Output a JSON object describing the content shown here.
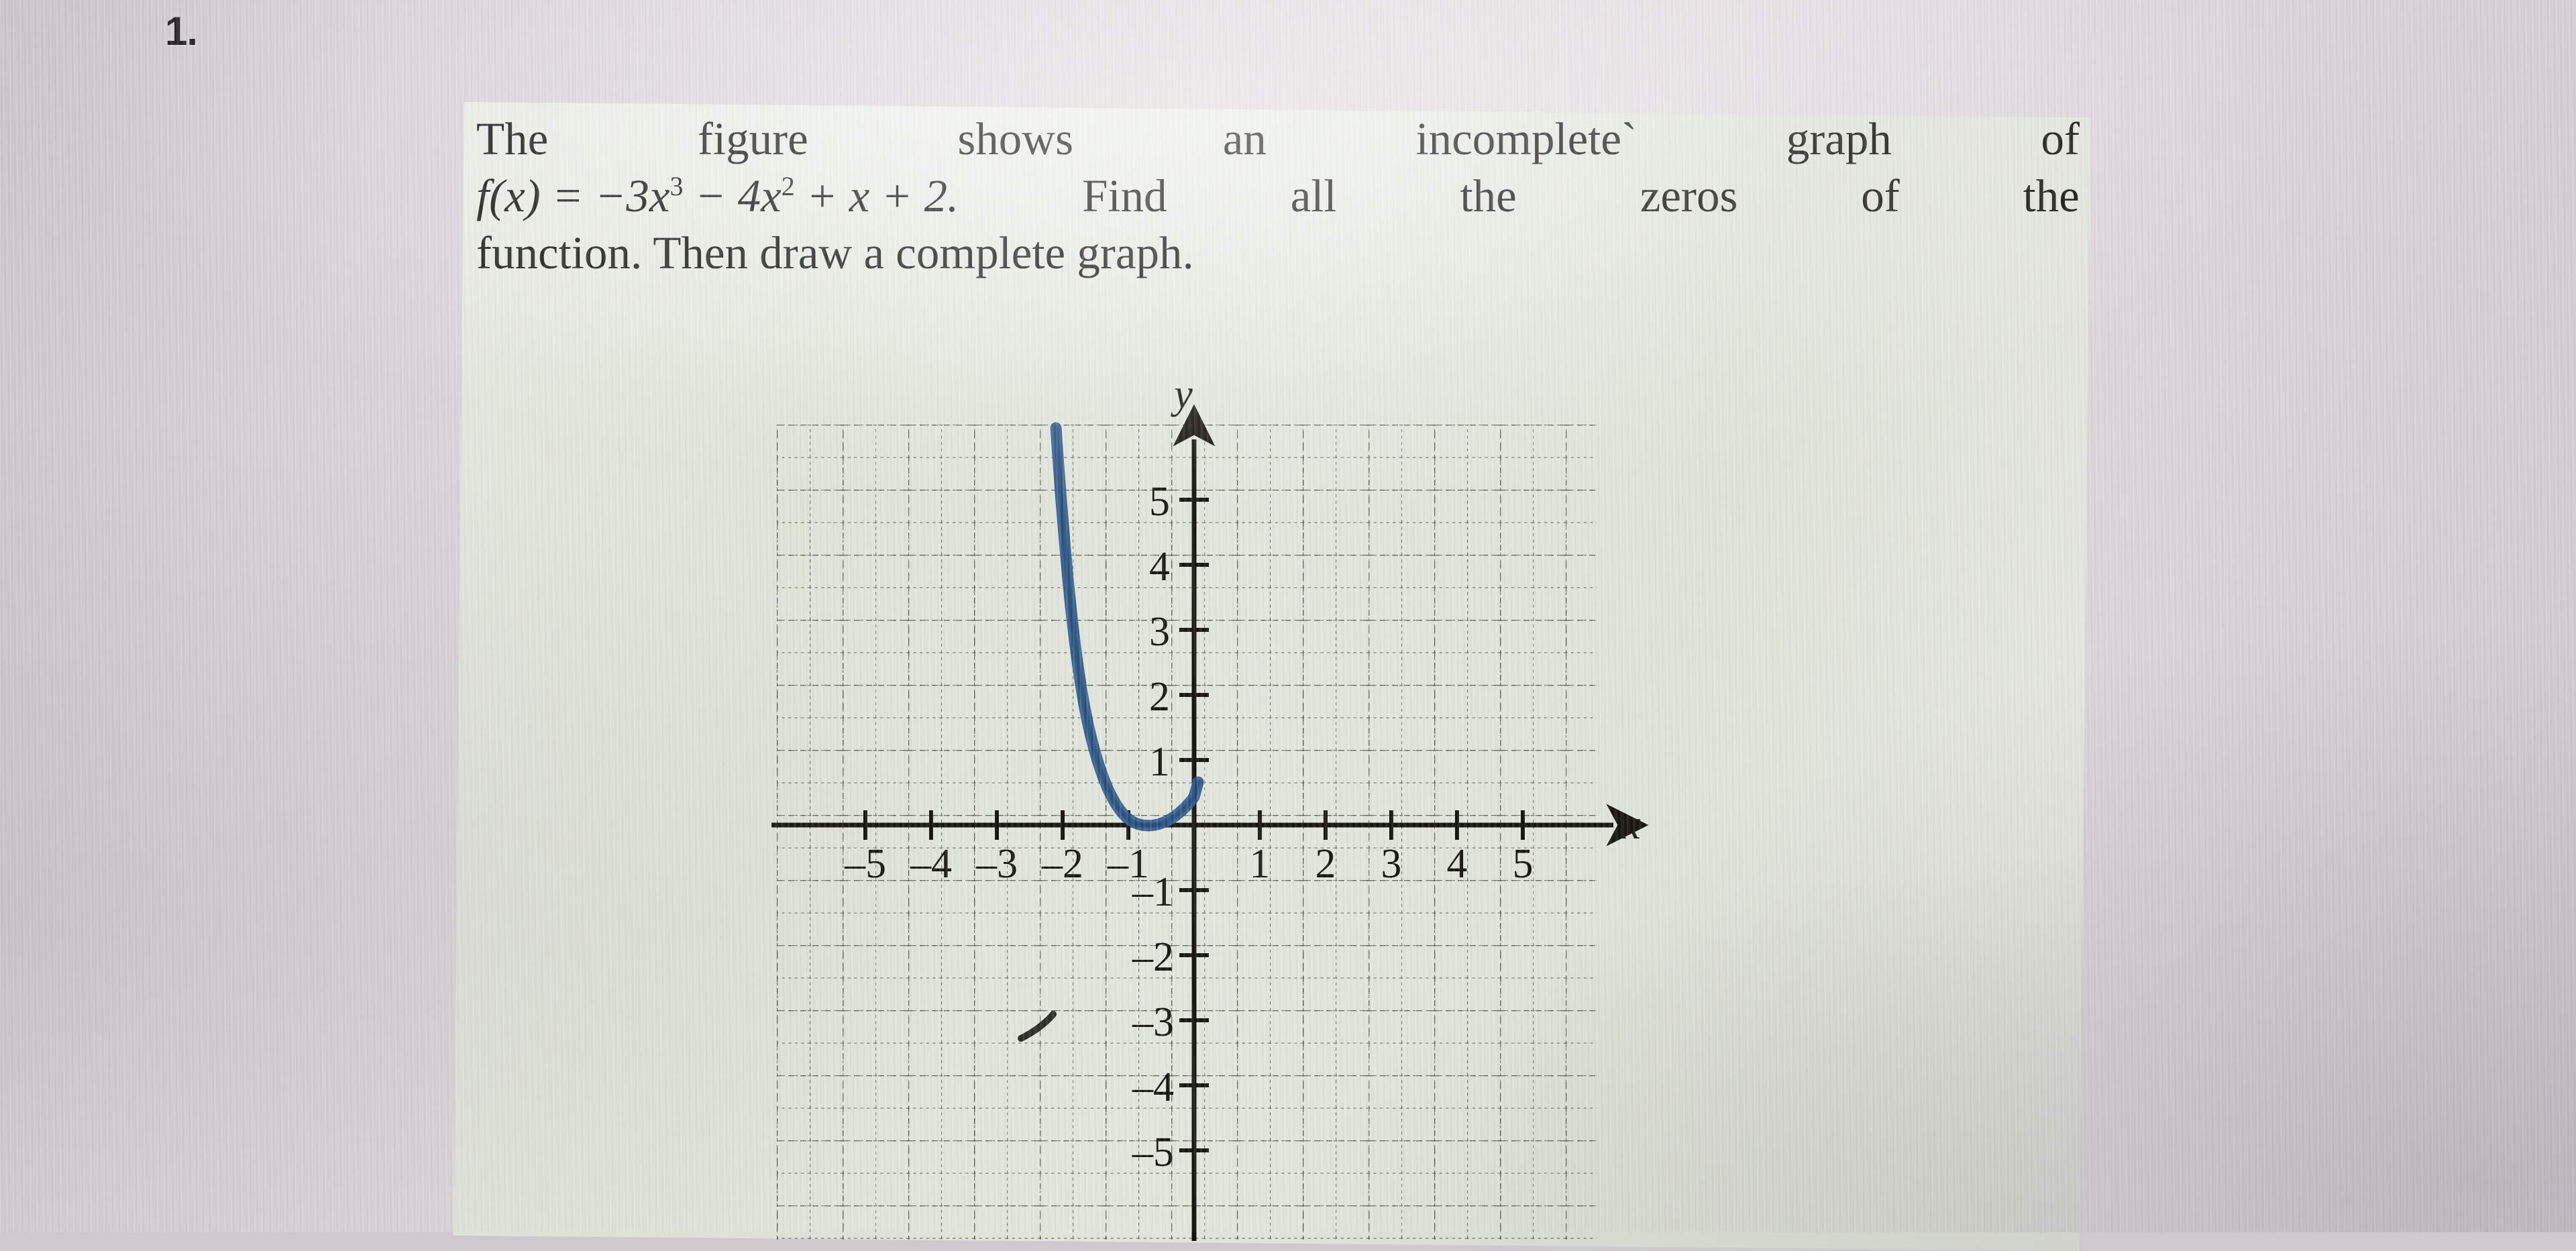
{
  "problem": {
    "number": "1.",
    "line1": [
      "The",
      "figure",
      "shows",
      "an",
      "incomplete`",
      "graph",
      "of"
    ],
    "line2_pre": "f(x) = −3x",
    "line2_exp1": "3",
    "line2_mid": " − 4x",
    "line2_exp2": "2",
    "line2_post": " + x + 2.",
    "line2_words": [
      "Find",
      "all",
      "the",
      "zeros",
      "of",
      "the"
    ],
    "line3": "function. Then draw a complete graph.",
    "full_text": "The figure shows an incomplete graph of f(x) = −3x³ − 4x² + x + 2. Find all the zeros of the function. Then draw a complete graph."
  },
  "chart_data": {
    "type": "line",
    "title": "",
    "xlabel": "x",
    "ylabel": "y",
    "xlim": [
      -6,
      6
    ],
    "ylim": [
      -6,
      6
    ],
    "xticks": [
      -5,
      -4,
      -3,
      -2,
      -1,
      1,
      2,
      3,
      4,
      5
    ],
    "yticks": [
      5,
      4,
      3,
      2,
      1,
      -1,
      -2,
      -3,
      -4,
      -5
    ],
    "xtick_labels": [
      "–5",
      "–4",
      "–3",
      "–2",
      "–1",
      "1",
      "2",
      "3",
      "4",
      "5"
    ],
    "ytick_labels": [
      "5",
      "4",
      "3",
      "2",
      "1",
      "–1",
      "–2",
      "–3",
      "–4",
      "–5"
    ],
    "grid": true,
    "grid_style": "dotted",
    "grid_spacing": 0.5,
    "axis_arrows": true,
    "legend": "none",
    "curve_color": "#2c5584",
    "curve_label": "f(x) = -3x^3 - 4x^2 + x + 2",
    "curve_note": "incomplete branch shown only for x in [-2.1, -0.62]",
    "series": [
      {
        "name": "f(x) = -3x^3 - 4x^2 + x + 2",
        "x": [
          -2.1,
          -2.05,
          -2.0,
          -1.9,
          -1.8,
          -1.7,
          -1.6,
          -1.5,
          -1.4,
          -1.3,
          -1.2,
          -1.1,
          -1.0,
          -0.95,
          -0.9,
          -0.85,
          -0.8,
          -0.75,
          -0.7,
          -0.66,
          -0.62
        ],
        "y": [
          6.0,
          5.49,
          4.0,
          3.27,
          2.65,
          2.13,
          1.7,
          1.38,
          1.13,
          0.95,
          0.83,
          0.76,
          0.72,
          0.72,
          0.73,
          0.76,
          0.8,
          0.86,
          0.93,
          0.98,
          1.04
        ]
      }
    ]
  },
  "marks": {
    "pencil_stroke": "short curved ink stroke below the x-axis near (-2.5, -3.3)"
  },
  "colors": {
    "screen_background": "#d6cfd5",
    "paper": "#dde2d6",
    "ink": "#14120f",
    "curve": "#2c5584",
    "grid": "#6f7a6c"
  }
}
